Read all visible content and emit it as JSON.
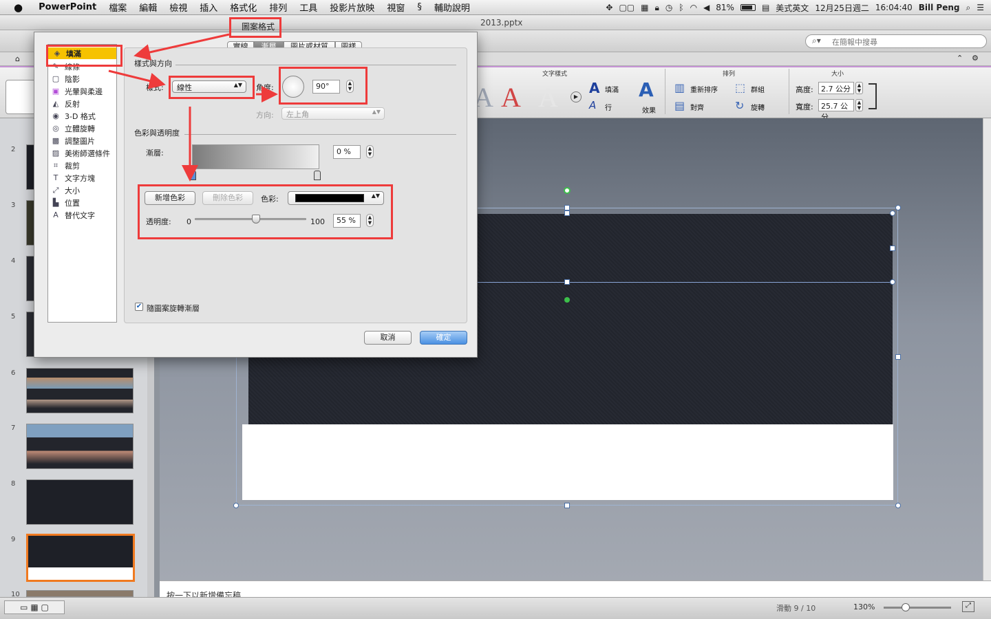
{
  "menubar": {
    "app": "PowerPoint",
    "items": [
      "檔案",
      "編輯",
      "檢視",
      "插入",
      "格式化",
      "排列",
      "工具",
      "投影片放映",
      "視窗",
      "輔助說明"
    ],
    "status": {
      "battery": "81%",
      "input": "美式英文",
      "date": "12月25日週二",
      "time": "16:04:40",
      "user": "Bill Peng"
    }
  },
  "window": {
    "title_partial": "2013.pptx"
  },
  "toolbar": {
    "search_placeholder": "在簡報中搜尋"
  },
  "ribbon": {
    "text_style_group": "文字樣式",
    "arrange_group": "排列",
    "size_group": "大小",
    "fill": "填滿",
    "line": "行",
    "effects": "效果",
    "reorder": "重新排序",
    "group": "群組",
    "align": "對齊",
    "rotate": "旋轉",
    "height_label": "高度:",
    "height_value": "2.7 公分",
    "width_label": "寬度:",
    "width_value": "25.7 公分"
  },
  "thumbnails": [
    "2",
    "3",
    "4",
    "5",
    "6",
    "7",
    "8",
    "9",
    "10"
  ],
  "notes": {
    "placeholder": "按一下以新增備忘稿"
  },
  "statusbar": {
    "slide": "滑動 9 / 10",
    "zoom": "130%"
  },
  "dialog": {
    "title": "圖案格式",
    "tabs": [
      "實線",
      "漸層",
      "圖片或材質",
      "圖樣"
    ],
    "active_tab": "漸層",
    "categories": [
      "填滿",
      "線條",
      "陰影",
      "光暈與柔邊",
      "反射",
      "3-D 格式",
      "立體旋轉",
      "調整圖片",
      "美術師選條件",
      "裁剪",
      "文字方塊",
      "大小",
      "位置",
      "替代文字"
    ],
    "selected_category": "填滿",
    "section_style": "樣式與方向",
    "style_label": "樣式:",
    "style_value": "線性",
    "angle_label": "角度:",
    "angle_value": "90°",
    "direction_label": "方向:",
    "direction_value": "左上角",
    "section_color": "色彩與透明度",
    "gradient_label": "漸層:",
    "gradient_position": "0 %",
    "add_color": "新增色彩",
    "delete_color": "刪除色彩",
    "color_label": "色彩:",
    "color_value": "#000000",
    "transparency_label": "透明度:",
    "transparency_min": "0",
    "transparency_max": "100",
    "transparency_value": "55 %",
    "transparency_level": 0.55,
    "rotate_with_shape": "隨圖案旋轉漸層",
    "rotate_with_shape_checked": true,
    "cancel": "取消",
    "ok": "確定"
  },
  "colors": {
    "highlight": "#ee3b3b",
    "selection": "#f6c200",
    "ribbon_accent": "#c694d6"
  }
}
